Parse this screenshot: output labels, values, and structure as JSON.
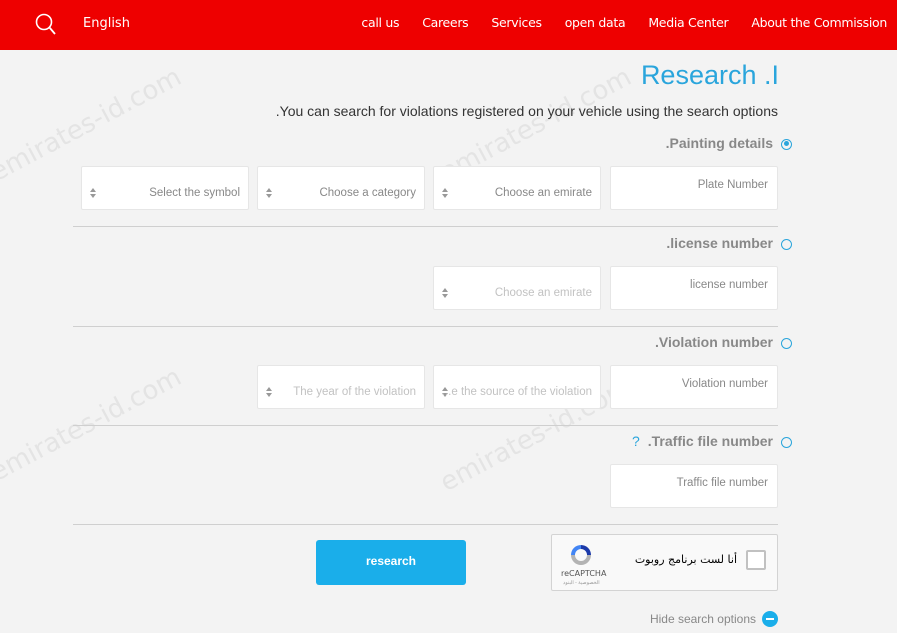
{
  "header": {
    "language_label": "English",
    "nav": [
      "call us",
      "Careers",
      "Services",
      "open data",
      "Media Center",
      "About the Commission"
    ],
    "brand_color": "#ee0000"
  },
  "watermark": "emirates-id.com",
  "page": {
    "title": "Research .I",
    "intro": ".You can search for violations registered on your vehicle using the search options"
  },
  "sections": {
    "plate": {
      "label": ".Painting details",
      "selected": true,
      "plate_number_placeholder": "Plate Number",
      "emirate_placeholder": "Choose an emirate",
      "category_placeholder": "Choose a category",
      "symbol_placeholder": "Select the symbol"
    },
    "license": {
      "label": ".license number",
      "selected": false,
      "license_number_placeholder": "license number",
      "emirate_placeholder": "Choose an emirate"
    },
    "violation": {
      "label": ".Violation number",
      "selected": false,
      "violation_number_placeholder": "Violation number",
      "source_placeholder": "...e the source of the violation",
      "year_placeholder": "The year of the violation"
    },
    "traffic": {
      "label": ".Traffic file number",
      "help": "?",
      "selected": false,
      "traffic_file_placeholder": "Traffic file number"
    }
  },
  "captcha": {
    "label": "أنا لست برنامج روبوت",
    "brand": "reCAPTCHA",
    "terms": "الخصوصية - البنود"
  },
  "actions": {
    "search_button": "research",
    "hide_options": "Hide search options"
  },
  "accent_color": "#2aa5dc"
}
